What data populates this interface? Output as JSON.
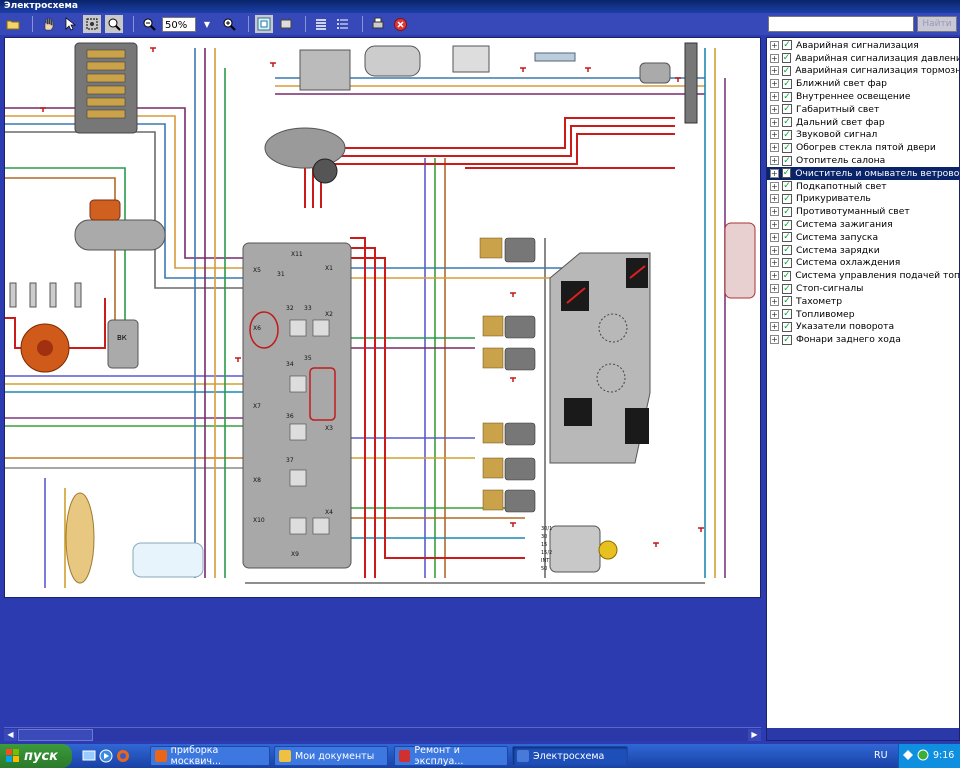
{
  "window": {
    "title": "Электросхема"
  },
  "toolbar": {
    "zoom_value": "50%",
    "icons": [
      "open-icon",
      "hand-icon",
      "pointer-icon",
      "select-icon",
      "zoom-fit-icon",
      "zoom-out-icon",
      "zoom-in-icon",
      "fit-window-icon",
      "component-icon",
      "layers-icon",
      "print-icon",
      "close-icon"
    ]
  },
  "search": {
    "placeholder": "",
    "find_label": "Найти"
  },
  "layers": [
    {
      "label": "Аварийная сигнализация",
      "checked": true,
      "selected": false
    },
    {
      "label": "Аварийная сигнализация давления масла",
      "checked": true,
      "selected": false
    },
    {
      "label": "Аварийная сигнализация тормозного привода",
      "checked": true,
      "selected": false
    },
    {
      "label": "Ближний свет фар",
      "checked": true,
      "selected": false
    },
    {
      "label": "Внутреннее освещение",
      "checked": true,
      "selected": false
    },
    {
      "label": "Габаритный свет",
      "checked": true,
      "selected": false
    },
    {
      "label": "Дальний свет фар",
      "checked": true,
      "selected": false
    },
    {
      "label": "Звуковой сигнал",
      "checked": true,
      "selected": false
    },
    {
      "label": "Обогрев стекла пятой двери",
      "checked": true,
      "selected": false
    },
    {
      "label": "Отопитель салона",
      "checked": true,
      "selected": false
    },
    {
      "label": "Очиститель и омыватель ветрового стекла",
      "checked": true,
      "selected": true
    },
    {
      "label": "Подкапотный свет",
      "checked": true,
      "selected": false
    },
    {
      "label": "Прикуриватель",
      "checked": true,
      "selected": false
    },
    {
      "label": "Противотуманный свет",
      "checked": true,
      "selected": false
    },
    {
      "label": "Система зажигания",
      "checked": true,
      "selected": false
    },
    {
      "label": "Система запуска",
      "checked": true,
      "selected": false
    },
    {
      "label": "Система зарядки",
      "checked": true,
      "selected": false
    },
    {
      "label": "Система охлаждения",
      "checked": true,
      "selected": false
    },
    {
      "label": "Система управления подачей топлива",
      "checked": true,
      "selected": false
    },
    {
      "label": "Стоп-сигналы",
      "checked": true,
      "selected": false
    },
    {
      "label": "Тахометр",
      "checked": true,
      "selected": false
    },
    {
      "label": "Топливомер",
      "checked": true,
      "selected": false
    },
    {
      "label": "Указатели поворота",
      "checked": true,
      "selected": false
    },
    {
      "label": "Фонари заднего хода",
      "checked": true,
      "selected": false
    }
  ],
  "diagram": {
    "fuse_block_labels": [
      "X11",
      "X1",
      "X5",
      "31",
      "32",
      "33",
      "X2",
      "X6",
      "34",
      "35",
      "X7",
      "36",
      "X3",
      "37",
      "X8",
      "X10",
      "X4",
      "X9"
    ],
    "ignition_labels": [
      "30/1",
      "30",
      "15",
      "15/2",
      "INT",
      "50"
    ],
    "coil_label": "ВК"
  },
  "taskbar": {
    "start_label": "пуск",
    "tasks": [
      {
        "label": "приборка москвич...",
        "active": false
      },
      {
        "label": "Мои документы",
        "active": false
      },
      {
        "label": "Ремонт и эксплуа...",
        "active": false
      },
      {
        "label": "Электросхема",
        "active": true
      }
    ],
    "language": "RU",
    "clock": "9:16"
  },
  "colors": {
    "window_bg": "#2d3bb0",
    "selected_row": "#0a246a",
    "wire_red": "#cc1b1b",
    "taskbar": "#245edb",
    "start": "#3c9a3c"
  }
}
